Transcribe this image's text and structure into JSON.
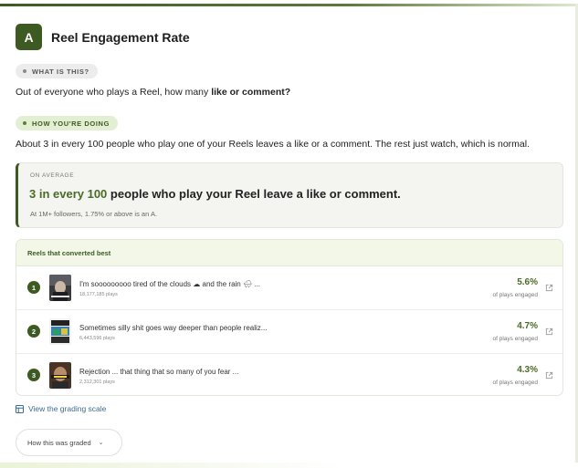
{
  "header": {
    "avatar_letter": "A",
    "title": "Reel Engagement Rate"
  },
  "what_is_this": {
    "pill": "WHAT IS THIS?",
    "text_prefix": "Out of everyone who plays a Reel, how many ",
    "text_bold": "like or comment?"
  },
  "how_doing": {
    "pill": "HOW YOU'RE DOING",
    "text": "About 3 in every 100 people who play one of your Reels leaves a like or a comment. The rest just watch, which is normal."
  },
  "average": {
    "label": "ON AVERAGE",
    "highlight": "3 in every 100",
    "main_rest": " people who play your Reel leave a like or comment.",
    "sub": "At 1M+ followers, 1.75% or above is an A."
  },
  "reels": {
    "heading": "Reels that converted best",
    "items": [
      {
        "rank": "1",
        "title": "I'm sooooooooo tired of the clouds ☁ and the rain 🌧 ...",
        "plays": "18,177,185 plays",
        "pct": "5.6%",
        "pct_label": "of plays engaged"
      },
      {
        "rank": "2",
        "title": "Sometimes silly shit goes way deeper than people realiz...",
        "plays": "6,443,596 plays",
        "pct": "4.7%",
        "pct_label": "of plays engaged"
      },
      {
        "rank": "3",
        "title": "Rejection ... that thing that so many of you fear ...",
        "plays": "2,312,301 plays",
        "pct": "4.3%",
        "pct_label": "of plays engaged"
      }
    ]
  },
  "grading_link": "View the grading scale",
  "graded_button": "How this was graded",
  "colors": {
    "accent": "#3d5a22",
    "accent_light": "#e3efd3",
    "link": "#3d6a96"
  }
}
